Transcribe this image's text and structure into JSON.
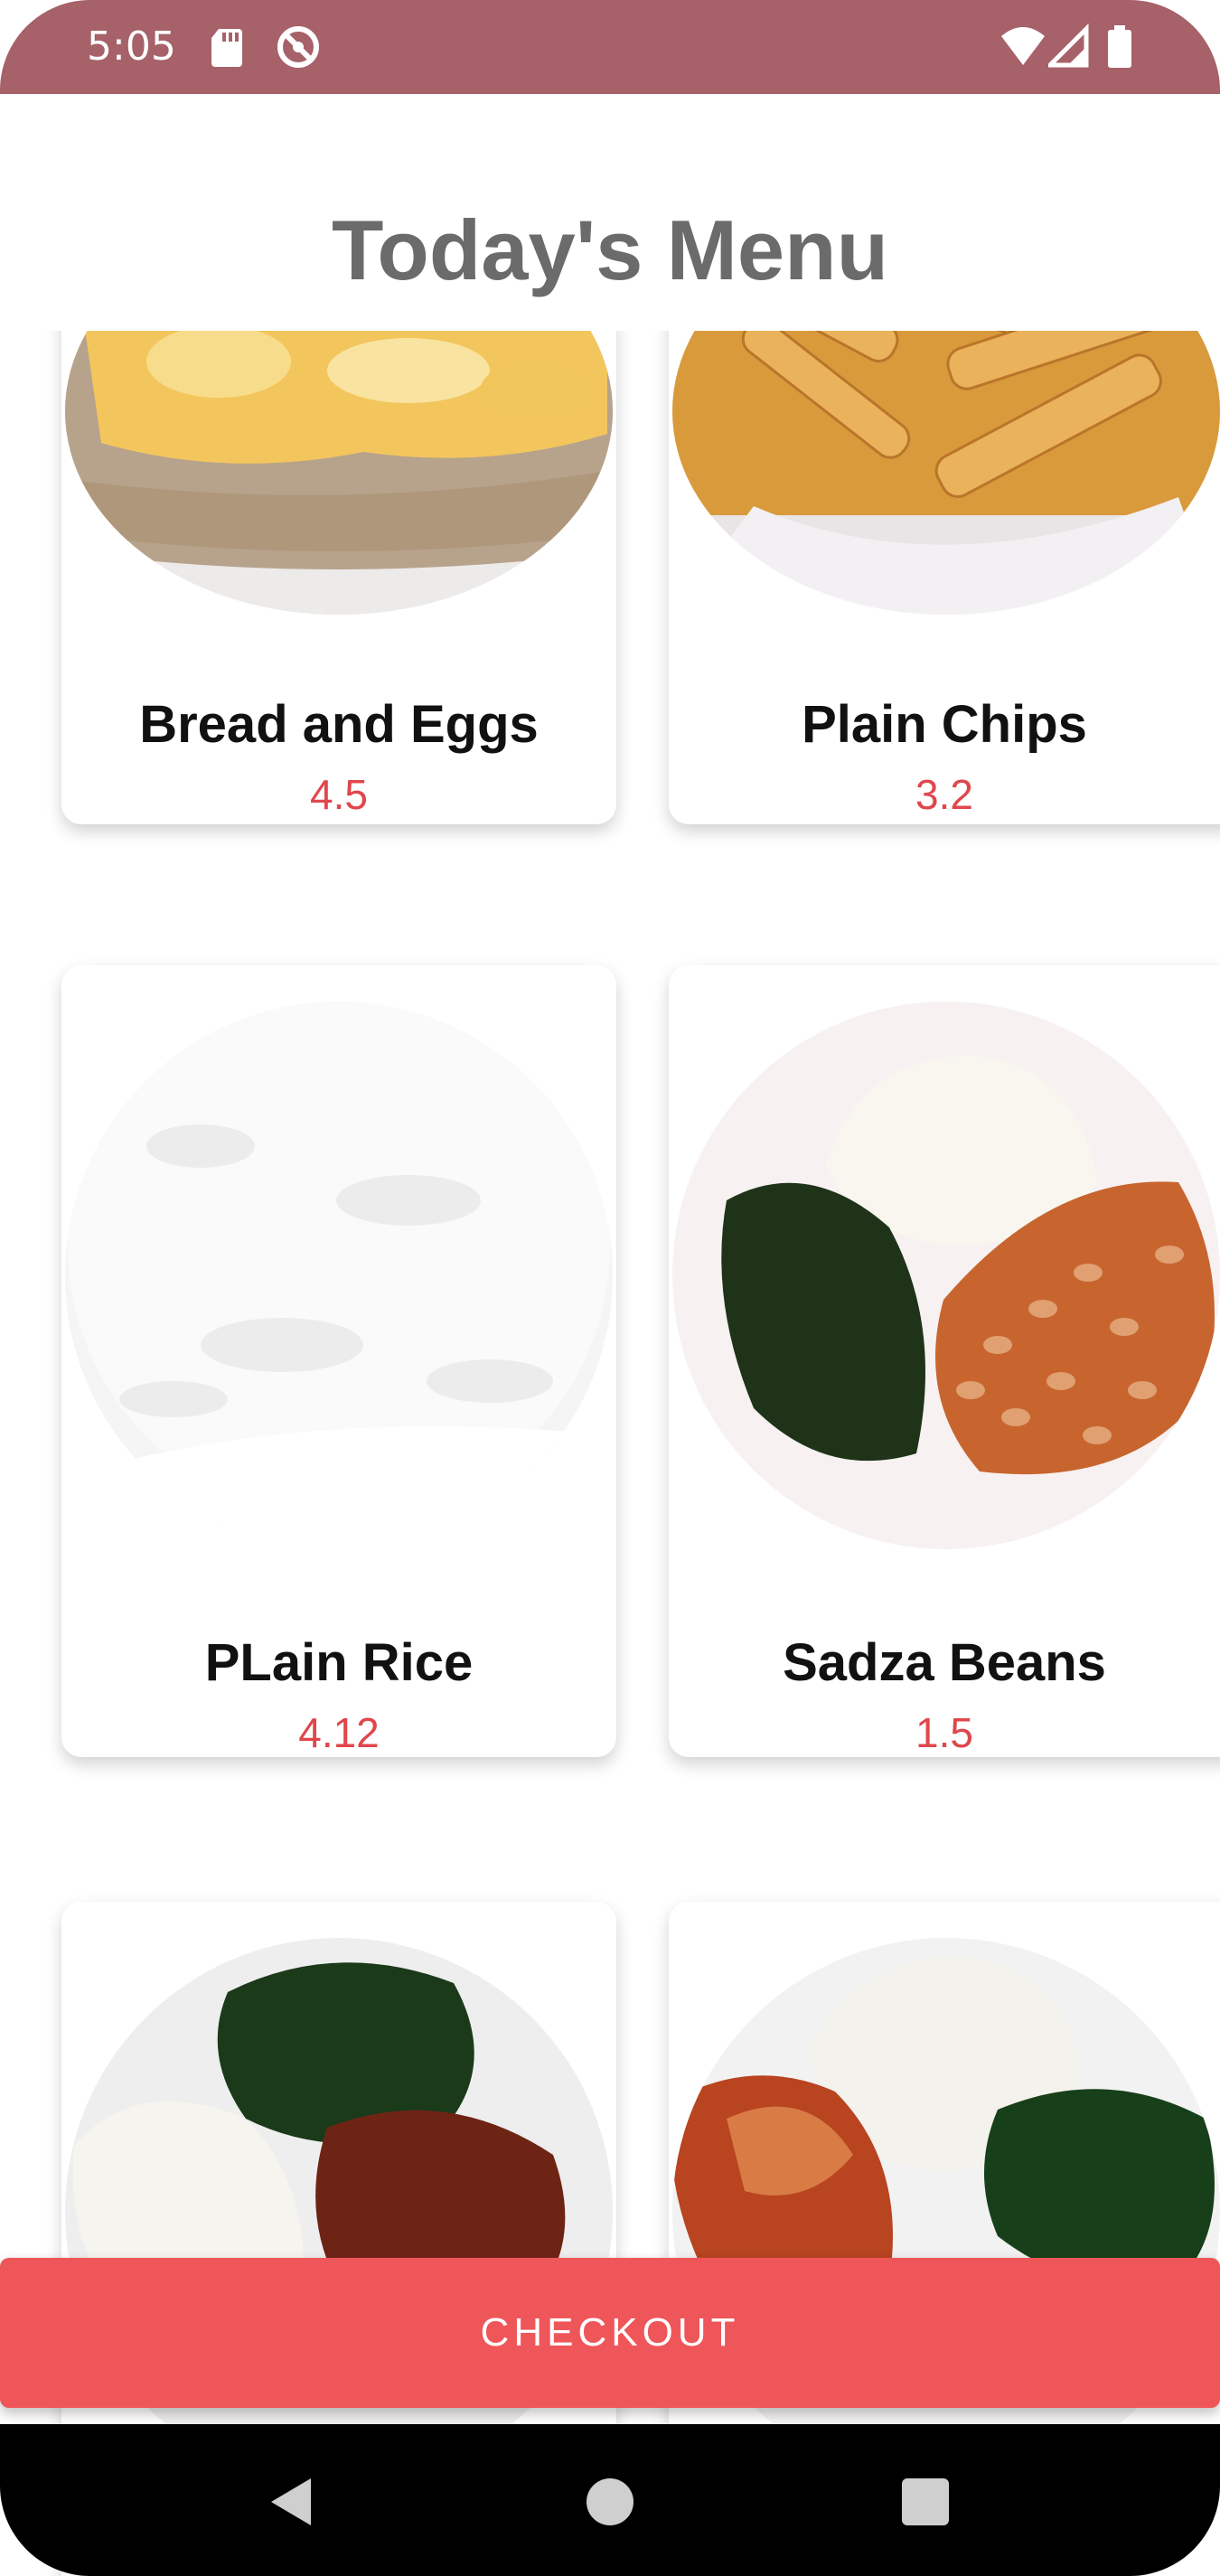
{
  "status_bar": {
    "time": "5:05",
    "left_icons": [
      "sd-card-icon",
      "do-not-disturb-icon"
    ],
    "right_icons": [
      "wifi-icon",
      "signal-icon",
      "battery-icon"
    ]
  },
  "header": {
    "title": "Today's Menu"
  },
  "menu_items": [
    {
      "name": "Bread and Eggs",
      "price": "4.5",
      "image": "bread-eggs-image"
    },
    {
      "name": "Plain Chips",
      "price": "3.2",
      "image": "plain-chips-image"
    },
    {
      "name": "PLain Rice",
      "price": "4.12",
      "image": "plain-rice-image"
    },
    {
      "name": "Sadza Beans",
      "price": "1.5",
      "image": "sadza-beans-image"
    },
    {
      "name": "",
      "price": "",
      "image": "sadza-greens-stew-image"
    },
    {
      "name": "",
      "price": "",
      "image": "sadza-chicken-image"
    }
  ],
  "checkout": {
    "label": "CHECKOUT"
  },
  "nav_bar": {
    "buttons": [
      "back-icon",
      "home-icon",
      "recents-icon"
    ]
  },
  "colors": {
    "status_bar": "#a66169",
    "accent": "#ef5659",
    "price": "#e0474c",
    "title": "#6b6b6b"
  }
}
